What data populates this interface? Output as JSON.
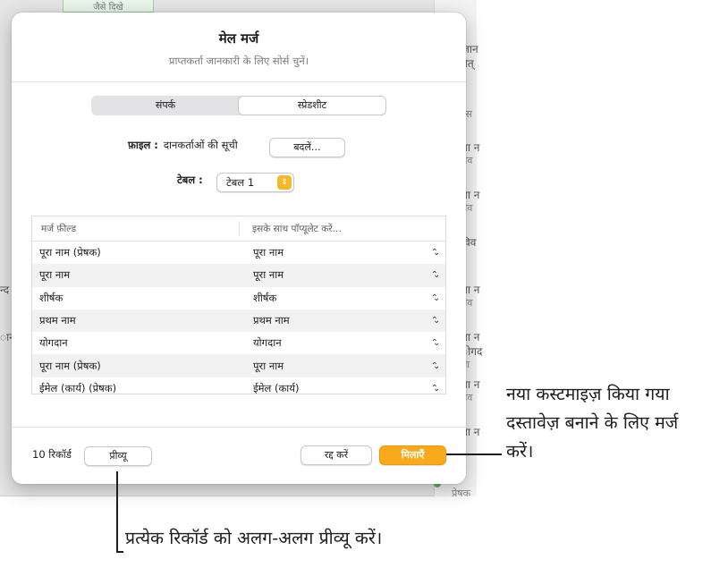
{
  "background": {
    "tab_text": "जैसे दिखे",
    "fragments": [
      {
        "id": "frag-1",
        "text": "जान"
      },
      {
        "id": "frag-2",
        "text": "तेत्"
      },
      {
        "id": "frag-3",
        "text": "रेस"
      },
      {
        "id": "frag-4",
        "text": "ता न"
      },
      {
        "id": "frag-5",
        "text": "तव"
      },
      {
        "id": "frag-6",
        "text": "ता न"
      },
      {
        "id": "frag-7",
        "text": "तव"
      },
      {
        "id": "frag-8",
        "text": "विव"
      },
      {
        "id": "frag-9",
        "text": "ता न"
      },
      {
        "id": "frag-10",
        "text": "तव"
      },
      {
        "id": "frag-11",
        "text": "ता न"
      },
      {
        "id": "frag-12",
        "text": "ोगद"
      },
      {
        "id": "frag-13",
        "text": "ता"
      },
      {
        "id": "frag-14",
        "text": "ता न"
      },
      {
        "id": "frag-15",
        "text": "तव"
      },
      {
        "id": "frag-16",
        "text": "ता न"
      },
      {
        "id": "frag-17",
        "text": "प्रेषक"
      },
      {
        "id": "frag-18",
        "text": "न्द"
      },
      {
        "id": "frag-19",
        "text": "ानं"
      }
    ]
  },
  "dialog": {
    "title": "मेल मर्ज",
    "subtitle": "प्राप्तकर्ता जानकारी के लिए सोर्स चुनें।",
    "source_tabs": [
      {
        "label": "संपर्क",
        "active": false
      },
      {
        "label": "स्प्रेडशीट",
        "active": true
      }
    ],
    "file_label": "फ़ाइल :",
    "file_name": "दानकर्ताओं की सूची",
    "change_button": "बदलें…",
    "table_label": "टेबल :",
    "table_value": "टेबल 1",
    "columns": {
      "merge_field": "मर्ज फ़ील्ड",
      "populate_with": "इसके साथ पॉप्यूलेट करें…"
    },
    "rows": [
      {
        "field": "पूरा नाम (प्रेषक)",
        "value": "पूरा नाम"
      },
      {
        "field": "पूरा नाम",
        "value": "पूरा नाम"
      },
      {
        "field": "शीर्षक",
        "value": "शीर्षक"
      },
      {
        "field": "प्रथम नाम",
        "value": "प्रथम नाम"
      },
      {
        "field": "योगदान",
        "value": "योगदान"
      },
      {
        "field": "पूरा नाम (प्रेषक)",
        "value": "पूरा नाम"
      },
      {
        "field": "ईमेल (कार्य) (प्रेषक)",
        "value": "ईमेल (कार्य)"
      }
    ],
    "record_count": "10 रिकॉर्ड",
    "preview_button": "प्रीव्यू",
    "cancel_button": "रद्द करें",
    "merge_button": "मिलाएँ"
  },
  "callouts": {
    "merge": "नया कस्टमाइज़ किया गया दस्तावेज़ बनाने के लिए मर्ज करें।",
    "preview": "प्रत्येक रिकॉर्ड को अलग-अलग प्रीव्यू करें।"
  },
  "colors": {
    "accent": "#f8a91c",
    "select_arrow": "#f5b72c"
  },
  "icons": {
    "row_stepper": "up-down-chevron-icon",
    "select_stepper": "up-down-chevron-icon"
  }
}
